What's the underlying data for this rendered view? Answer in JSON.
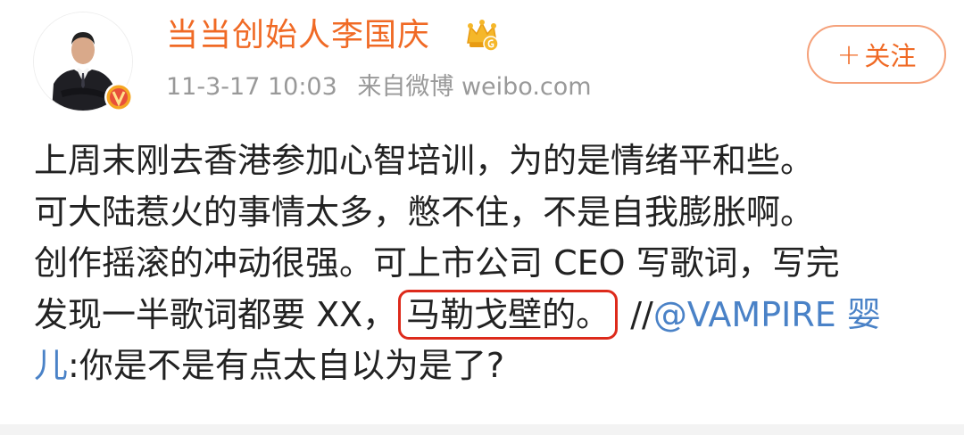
{
  "post": {
    "author": "当当创始人李国庆",
    "time": "11-3-17 10:03",
    "source": "来自微博 weibo.com",
    "follow_plus": "+",
    "follow_label": "关注",
    "lines": {
      "l1": "上周末刚去香港参加心智培训，为的是情绪平和些。",
      "l2": "可大陆惹火的事情太多，憋不住，不是自我膨胀啊。",
      "l3": "创作摇滚的冲动很强。可上市公司 CEO 写歌词，写完",
      "l4_pre": "发现一半歌词都要 XX，",
      "l4_highlight": "马勒戈壁的。",
      "l4_repost": " //",
      "l4_mention": "@VAMPIRE 婴",
      "l5_mention": "儿",
      "l5_text": ":你是不是有点太自以为是了?"
    }
  },
  "colors": {
    "name": "#f06a25",
    "meta": "#999999",
    "link": "#4a82c7",
    "highlight_border": "#dd2a1b"
  },
  "icons": {
    "badge": "verified-v-icon",
    "crown": "member-crown-icon"
  }
}
